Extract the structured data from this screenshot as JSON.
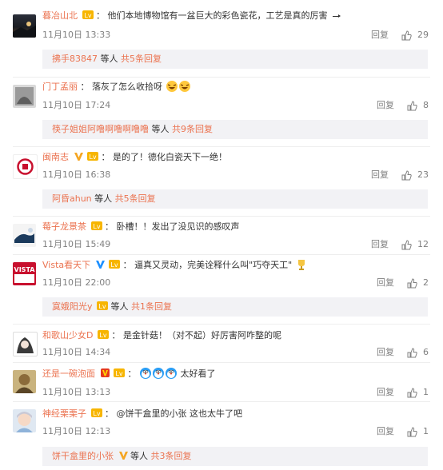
{
  "colors": {
    "username": "#eb7350",
    "meta": "#808080",
    "sub_bg": "#f2f2f5",
    "gold_v": "#f5a623",
    "blue_v": "#1e90ff"
  },
  "labels": {
    "reply": "回复",
    "colon": "：",
    "dengren": "等人",
    "gong": "共",
    "tiaohuifu": "条回复"
  },
  "comments": [
    {
      "user": "暮冶山北",
      "text": "他们本地博物馆有一盆巨大的彩色瓷花，工艺是真的厉害",
      "time": "11月10日 13:33",
      "likes": "29",
      "sub": {
        "user": "拂手83847",
        "count": "5"
      }
    },
    {
      "user": "门丁孟丽",
      "text": "落灰了怎么收拾呀",
      "time": "11月10日 17:24",
      "likes": "8",
      "sub": {
        "user": "筷子姐姐阿噜啊噜啊噜噜",
        "count": "9"
      }
    },
    {
      "user": "闽南志",
      "text": "是的了！德化白瓷天下一绝！",
      "time": "11月10日 16:38",
      "likes": "23",
      "sub": {
        "user": "阿昏ahun",
        "count": "5"
      }
    },
    {
      "user": "莓子龙景茶",
      "text": "卧槽！！发出了没见识的感叹声",
      "time": "11月10日 15:49",
      "likes": "12"
    },
    {
      "user": "Vista看天下",
      "text": "逼真又灵动，完美诠释什么叫\"巧夺天工\"",
      "time": "11月10日 22:00",
      "likes": "2",
      "sub": {
        "user": "寞娥阳光y",
        "count": "1"
      }
    },
    {
      "user": "和歌山少女D",
      "text": "是金针菇！（对不起）好厉害阿咋整的呢",
      "time": "11月10日 14:34",
      "likes": "6"
    },
    {
      "user": "还是一碗泡面",
      "text": "太好看了",
      "time": "11月10日 13:13",
      "likes": "1"
    },
    {
      "user": "神经栗栗子",
      "text": "@饼干盒里的小张 这也太牛了吧",
      "time": "11月10日 12:13",
      "likes": "1",
      "sub": {
        "user": "饼干盒里的小张",
        "count": "3"
      }
    }
  ]
}
